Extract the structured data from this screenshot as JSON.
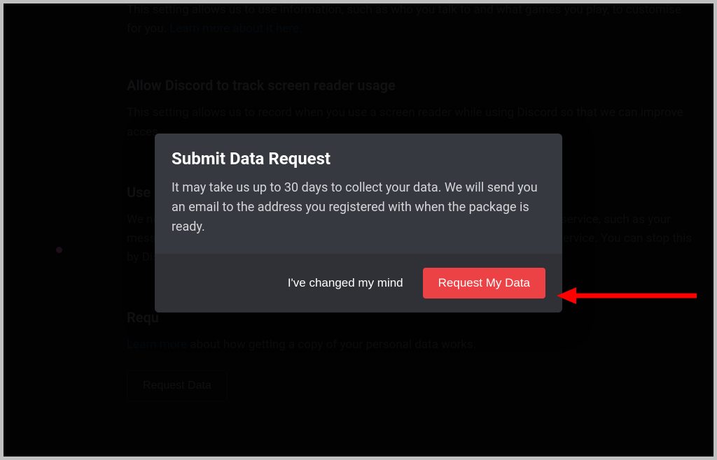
{
  "background": {
    "section1": {
      "desc_prefix": "This setting allows us to use information, such as who you talk to and what games you play, to customise",
      "desc_cont": "for you. ",
      "link": "Learn more about it here."
    },
    "section2": {
      "title": "Allow Discord to track screen reader usage",
      "desc": "This setting allows us to record when you use a screen reader while using Discord so that we can improve acces..."
    },
    "section3": {
      "title": "Use",
      "desc": "We need to store and process some data in order to provide you the basic Discord service, such as your messa what servers you're in. By using Discord, you allow us to provide this basic service. You can stop this by Disabling or Deleting your account."
    },
    "section4": {
      "title": "Requ",
      "desc_link": "Learn more",
      "desc_rest": " about how getting a copy of your personal data works.",
      "button": "Request Data"
    }
  },
  "modal": {
    "title": "Submit Data Request",
    "text": "It may take us up to 30 days to collect your data. We will send you an email to the address you registered with when the package is ready.",
    "cancel": "I've changed my mind",
    "confirm": "Request My Data"
  },
  "annotation": {
    "color": "#ff0000"
  }
}
